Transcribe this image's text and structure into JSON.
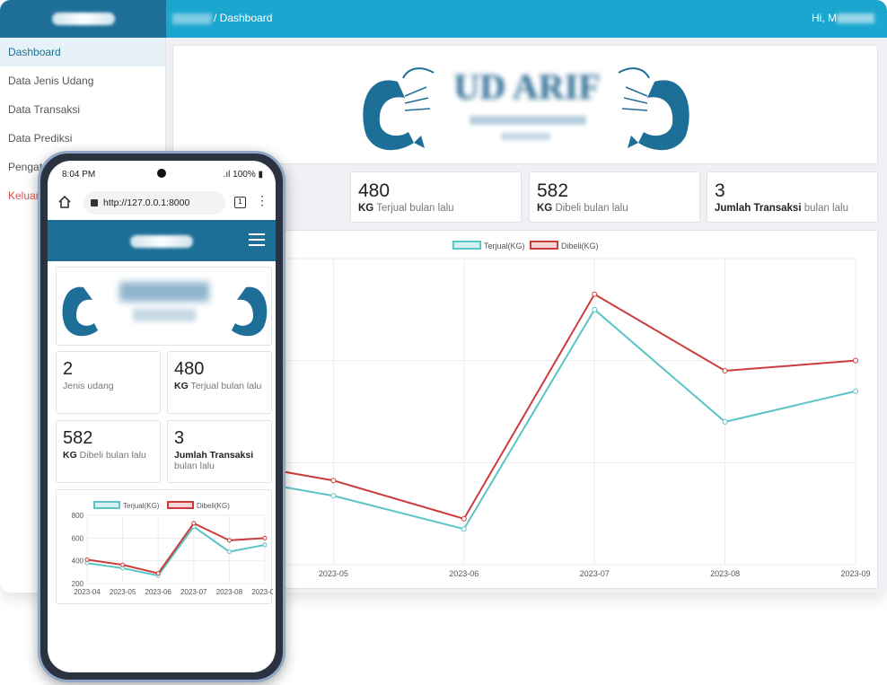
{
  "desktop": {
    "breadcrumb": "/ Dashboard",
    "greeting": "Hi, M",
    "sidebar": [
      {
        "label": "Dashboard"
      },
      {
        "label": "Data Jenis Udang"
      },
      {
        "label": "Data Transaksi"
      },
      {
        "label": "Data Prediksi"
      },
      {
        "label": "Pengat"
      },
      {
        "label": "Keluar"
      }
    ],
    "hero_text": "UD ARIF",
    "stats": [
      {
        "num": "480",
        "strong": "KG",
        "rest": " Terjual bulan lalu"
      },
      {
        "num": "582",
        "strong": "KG",
        "rest": " Dibeli bulan lalu"
      },
      {
        "num": "3",
        "strong": "Jumlah Transaksi",
        "rest": " bulan lalu"
      }
    ]
  },
  "mobile": {
    "time": "8:04 PM",
    "battery": "100%",
    "url": "http://127.0.0.1:8000",
    "tab_count": "1",
    "stats": [
      {
        "num": "2",
        "strong": "",
        "rest": "Jenis udang"
      },
      {
        "num": "480",
        "strong": "KG",
        "rest": " Terjual bulan lalu"
      },
      {
        "num": "582",
        "strong": "KG",
        "rest": " Dibeli bulan lalu"
      },
      {
        "num": "3",
        "strong": "Jumlah Transaksi",
        "rest": " bulan lalu"
      }
    ]
  },
  "colors": {
    "terjual": "#5bc4c6",
    "dibeli": "#cd3c3c",
    "navy": "#1e6f98",
    "topbar": "#1ba6cf"
  },
  "chart_data": {
    "type": "line",
    "categories": [
      "2023-04",
      "2023-05",
      "2023-06",
      "2023-07",
      "2023-08",
      "2023-09"
    ],
    "series": [
      {
        "name": "Terjual(KG)",
        "values": [
          380,
          335,
          270,
          700,
          480,
          540
        ]
      },
      {
        "name": "Dibeli(KG)",
        "values": [
          410,
          365,
          290,
          730,
          580,
          600
        ]
      }
    ],
    "yticks": [
      200,
      400,
      600,
      800
    ],
    "ylim": [
      200,
      800
    ],
    "legend": "top"
  }
}
